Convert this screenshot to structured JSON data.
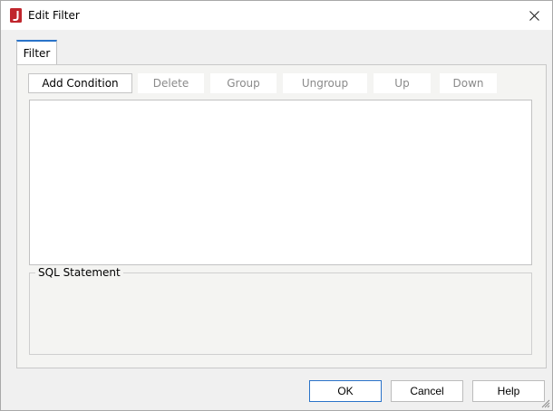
{
  "window": {
    "title": "Edit Filter"
  },
  "tabs": [
    {
      "label": "Filter",
      "active": true
    }
  ],
  "toolbar": {
    "add_condition": "Add Condition",
    "delete": "Delete",
    "group": "Group",
    "ungroup": "Ungroup",
    "up": "Up",
    "down": "Down"
  },
  "sql": {
    "label": "SQL Statement",
    "value": ""
  },
  "footer": {
    "ok": "OK",
    "cancel": "Cancel",
    "help": "Help"
  },
  "colors": {
    "accent": "#2a73c9",
    "app_icon": "#c0262d",
    "disabled_text": "#8a8a8a"
  },
  "icons": {
    "app": "j-logo-icon",
    "close": "close-icon",
    "resize": "resize-grip-icon"
  }
}
